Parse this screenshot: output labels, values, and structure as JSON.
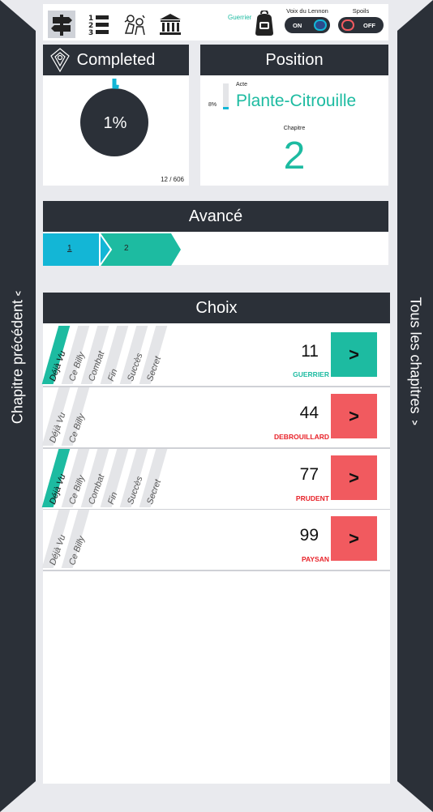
{
  "nav": {
    "left_label": "Chapitre précédent",
    "left_caret": "^",
    "right_label": "Tous les chapitres",
    "right_caret": "^"
  },
  "toolbar": {
    "class_name": "Guerrier",
    "voice": {
      "label": "Voix du Lennon",
      "state": "ON"
    },
    "spoils": {
      "label": "Spoils",
      "state": "OFF"
    }
  },
  "completed": {
    "title": "Completed",
    "percent_label": "1%",
    "progress": 0.0198,
    "count": "12 / 606"
  },
  "position": {
    "title": "Position",
    "act_label": "Acte",
    "act_name": "Plante-Citrouille",
    "act_percent": "8%",
    "act_progress": 0.08,
    "chapter_label": "Chapitre",
    "chapter": "2"
  },
  "avance": {
    "title": "Avancé",
    "steps": [
      "1",
      "2"
    ]
  },
  "choix": {
    "title": "Choix",
    "tag_names": [
      "Déjà Vu",
      "Ce Billy",
      "Combat",
      "Fin",
      "Succès",
      "Secret"
    ],
    "rows": [
      {
        "number": "11",
        "cls": "GUERRIER",
        "tags": 6,
        "deja_vu": true
      },
      {
        "number": "44",
        "cls": "DEBROUILLARD",
        "tags": 2,
        "deja_vu": false
      },
      {
        "number": "77",
        "cls": "PRUDENT",
        "tags": 6,
        "deja_vu": true
      },
      {
        "number": "99",
        "cls": "PAYSAN",
        "tags": 2,
        "deja_vu": false
      }
    ],
    "button_label": ">"
  },
  "colors": {
    "dark": "#2b3038",
    "teal": "#1dbba1",
    "blue": "#13b6d6",
    "red": "#f15a5f",
    "bg": "#e9eaee"
  }
}
